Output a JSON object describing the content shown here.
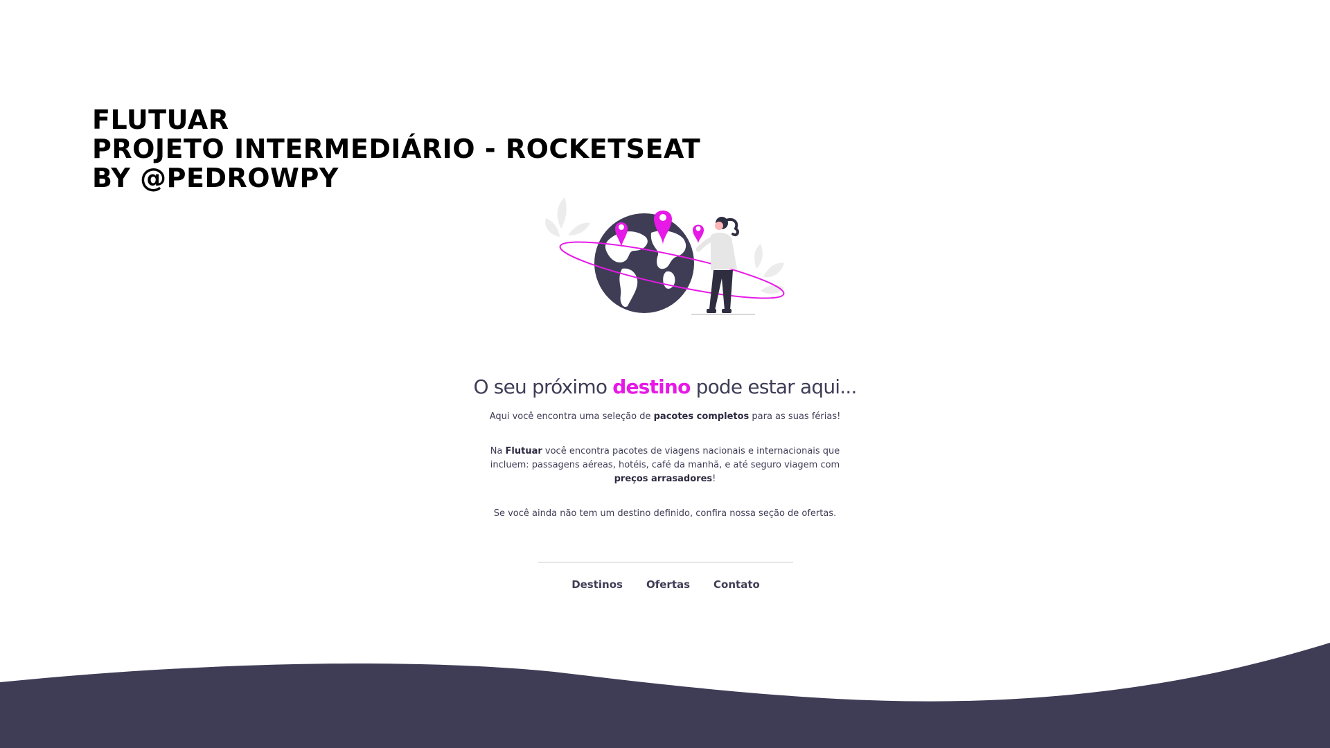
{
  "header": {
    "line1": "FLUTUAR",
    "line2": "PROJETO INTERMEDIÁRIO - ROCKETSEAT",
    "line3": "BY @PEDROWPY"
  },
  "hero": {
    "headline_before": "O seu próximo ",
    "headline_accent": "destino",
    "headline_after": " pode estar aqui...",
    "p1_before": "Aqui você encontra uma seleção de ",
    "p1_bold": "pacotes completos",
    "p1_after": " para as suas férias!",
    "p2_before": "Na ",
    "p2_bold1": "Flutuar",
    "p2_middle": " você encontra pacotes de viagens nacionais e internacionais que incluem: passagens aéreas, hotéis, café da manhã, e até seguro viagem com ",
    "p2_bold2": "preços arrasadores",
    "p2_after": "!",
    "p3": "Se você ainda não tem um destino definido, confira nossa seção de ofertas."
  },
  "nav": {
    "items": [
      "Destinos",
      "Ofertas",
      "Contato"
    ]
  },
  "colors": {
    "accent": "#e619e6",
    "dark": "#3f3d56",
    "wave": "#3f3d56"
  },
  "icons": {
    "illustration": "traveler-globe-illustration"
  }
}
